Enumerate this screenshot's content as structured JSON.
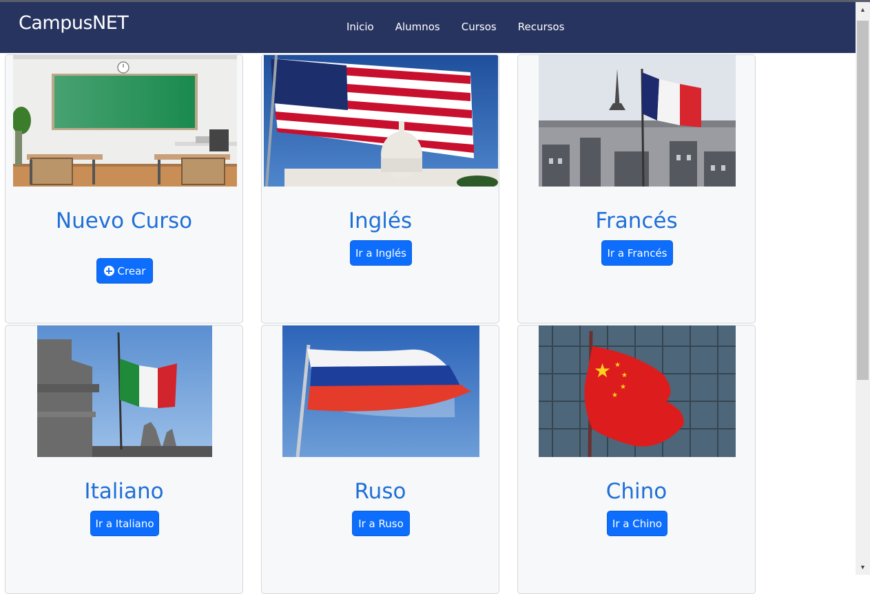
{
  "navbar": {
    "brand": "CampusNET",
    "links": [
      "Inicio",
      "Alumnos",
      "Cursos",
      "Recursos"
    ]
  },
  "cards": [
    {
      "title": "Nuevo Curso",
      "button": "Crear",
      "image": "classroom-image"
    },
    {
      "title": "Inglés",
      "button": "Ir a Inglés",
      "image": "usa-flag-image"
    },
    {
      "title": "Francés",
      "button": "Ir a Francés",
      "image": "france-flag-image"
    },
    {
      "title": "Italiano",
      "button": "Ir a Italiano",
      "image": "italy-flag-image"
    },
    {
      "title": "Ruso",
      "button": "Ir a Ruso",
      "image": "russia-flag-image"
    },
    {
      "title": "Chino",
      "button": "Ir a Chino",
      "image": "china-flag-image"
    }
  ],
  "colors": {
    "navbar": "#283460",
    "primary_button": "#0d6efd",
    "title": "#1f6fd6"
  }
}
